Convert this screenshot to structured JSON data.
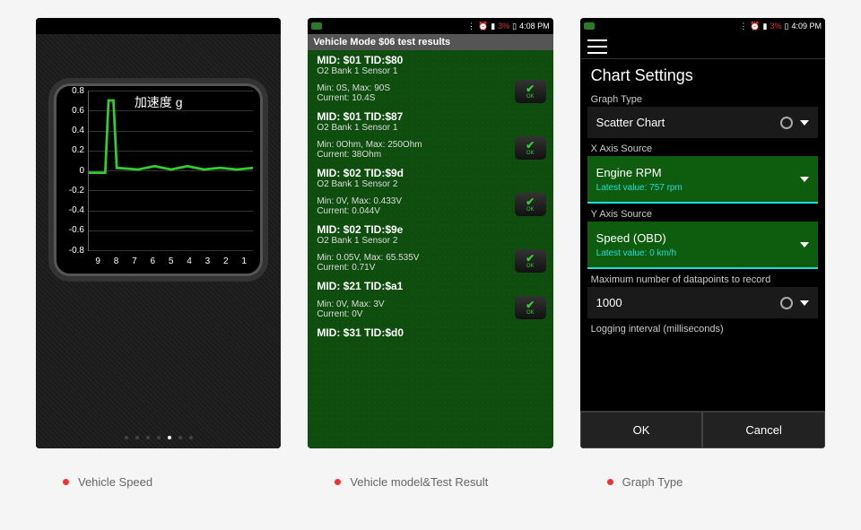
{
  "statusbar": {
    "battery_pct1": "3%",
    "time1": "4:08 PM",
    "battery_pct2": "3%",
    "time2": "4:09 PM"
  },
  "screen1": {
    "gauge_title": "加速度 g",
    "y_ticks": [
      "0.8",
      "0.6",
      "0.4",
      "0.2",
      "0",
      "-0.2",
      "-0.4",
      "-0.6",
      "-0.8"
    ],
    "x_ticks": [
      "9",
      "8",
      "7",
      "6",
      "5",
      "4",
      "3",
      "2",
      "1"
    ]
  },
  "chart_data": {
    "type": "line",
    "title": "加速度 g",
    "xlabel": "",
    "ylabel": "",
    "ylim": [
      -0.9,
      0.9
    ],
    "x": [
      9,
      8.5,
      8.3,
      8.1,
      8,
      7,
      6,
      5,
      4,
      3,
      2,
      1
    ],
    "values": [
      0,
      0,
      0.85,
      0.85,
      0.05,
      0.06,
      0.04,
      0.07,
      0.05,
      0.06,
      0.04,
      0.05
    ]
  },
  "screen2": {
    "header": "Vehicle Mode $06 test results",
    "items": [
      {
        "head": "MID: $01 TID:$80",
        "sub": "O2 Bank 1 Sensor 1",
        "vals": "Min: 0S, Max: 90S\nCurrent: 10.4S"
      },
      {
        "head": "MID: $01 TID:$87",
        "sub": "O2 Bank 1 Sensor 1",
        "vals": "Min: 0Ohm, Max: 250Ohm\nCurrent: 38Ohm"
      },
      {
        "head": "MID: $02 TID:$9d",
        "sub": "O2 Bank 1 Sensor 2",
        "vals": "Min: 0V, Max: 0.433V\nCurrent: 0.044V"
      },
      {
        "head": "MID: $02 TID:$9e",
        "sub": "O2 Bank 1 Sensor 2",
        "vals": "Min: 0.05V, Max: 65.535V\nCurrent: 0.71V"
      },
      {
        "head": "MID: $21 TID:$a1",
        "sub": "",
        "vals": "Min: 0V, Max: 3V\nCurrent: 0V"
      },
      {
        "head": "MID: $31 TID:$d0",
        "sub": "",
        "vals": ""
      }
    ],
    "ok_label": "OK"
  },
  "screen3": {
    "title": "Chart Settings",
    "graph_type_label": "Graph Type",
    "graph_type_value": "Scatter Chart",
    "x_axis_label": "X Axis Source",
    "x_axis_value": "Engine RPM",
    "x_axis_sub": "Latest value: 757 rpm",
    "y_axis_label": "Y Axis Source",
    "y_axis_value": "Speed (OBD)",
    "y_axis_sub": "Latest value: 0 km/h",
    "max_dp_label": "Maximum number of datapoints to record",
    "max_dp_value": "1000",
    "interval_label": "Logging interval (milliseconds)",
    "ok": "OK",
    "cancel": "Cancel"
  },
  "captions": {
    "c1": "Vehicle Speed",
    "c2": "Vehicle model&Test Result",
    "c3": "Graph Type"
  }
}
